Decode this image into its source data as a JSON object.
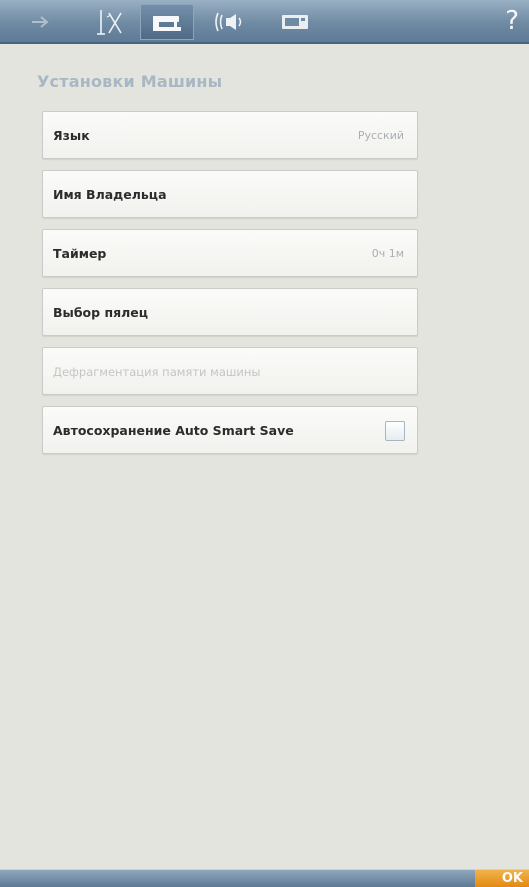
{
  "topbar": {
    "tabs": [
      {
        "icon": "arrow-icon",
        "active": false
      },
      {
        "icon": "presser-foot-icon",
        "active": false
      },
      {
        "icon": "sewing-machine-icon",
        "active": true
      },
      {
        "icon": "sound-icon",
        "active": false
      },
      {
        "icon": "screen-icon",
        "active": false
      }
    ],
    "help_label": "?"
  },
  "page_title": "Установки Машины",
  "settings": [
    {
      "label": "Язык",
      "value": "Русский",
      "enabled": true
    },
    {
      "label": "Имя Владельца",
      "value": "",
      "enabled": true
    },
    {
      "label": "Таймер",
      "value": "0ч 1м",
      "enabled": true
    },
    {
      "label": "Выбор пялец",
      "value": "",
      "enabled": true
    },
    {
      "label": "Дефрагментация памяти машины",
      "value": "",
      "enabled": false
    },
    {
      "label": "Автосохранение Auto Smart Save",
      "checkbox": true,
      "checked": false,
      "enabled": true
    }
  ],
  "bottombar": {
    "ok_label": "OK"
  },
  "colors": {
    "accent": "#6f8aa3",
    "ok": "#e8961e",
    "title": "#a8b7c4"
  }
}
